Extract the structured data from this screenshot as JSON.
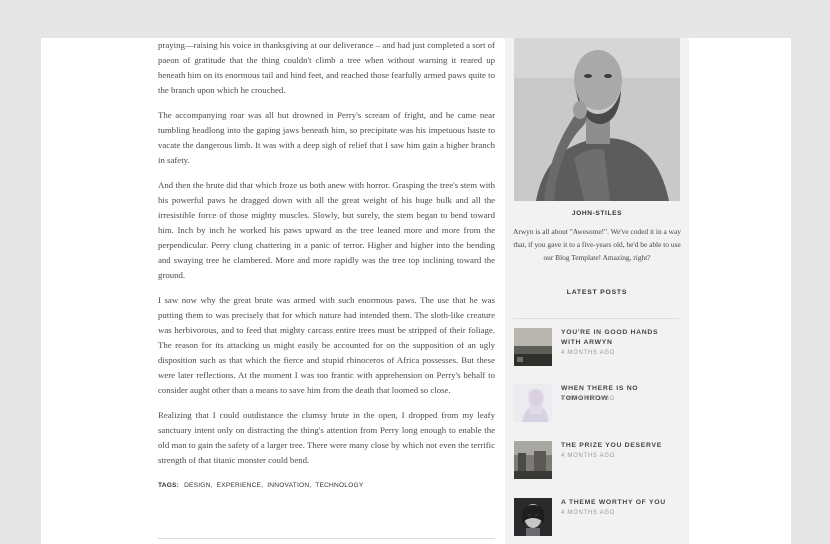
{
  "article": {
    "paragraphs": [
      "praying—raising his voice in thanksgiving at our deliverance – and had just completed a sort of paeon of gratitude that the thing couldn't climb a tree when without warning it reared up beneath him on its enormous tail and hind feet, and reached those fearfully armed paws quite to the branch upon which he crouched.",
      "The accompanying roar was all but drowned in Perry's scream of fright, and he came near tumbling headlong into the gaping jaws beneath him, so precipitate was his impetuous haste to vacate the dangerous limb. It was with a deep sigh of relief that I saw him gain a higher branch in safety.",
      "And then the brute did that which froze us both anew with horror. Grasping the tree's stem with his powerful paws he dragged down with all the great weight of his huge bulk and all the irresistible force of those mighty muscles. Slowly, but surely, the stem began to bend toward him. Inch by inch he worked his paws upward as the tree leaned more and more from the perpendicular. Perry clung chattering in a panic of terror. Higher and higher into the bending and swaying tree he clambered. More and more rapidly was the tree top inclining toward the ground.",
      "I saw now why the great brute was armed with such enormous paws. The use that he was putting them to was precisely that for which nature had intended them. The sloth-like creature was herbivorous, and to feed that mighty carcass entire trees must be stripped of their foliage. The reason for its attacking us might easily be accounted for on the supposition of an ugly disposition such as that which the fierce and stupid rhinoceros of Africa possesses. But these were later reflections. At the moment I was too frantic with apprehension on Perry's behalf to consider aught other than a means to save him from the death that loomed so close.",
      "Realizing that I could outdistance the clumsy brute in the open, I dropped from my leafy sanctuary intent only on distracting the thing's attention from Perry long enough to enable the old man to gain the safety of a larger tree. There were many close by which not even the terrific strength of that titanic monster could bend."
    ],
    "tags_label": "TAGS:",
    "tags": [
      "DESIGN,",
      "EXPERIENCE,",
      "INNOVATION,",
      "TECHNOLOGY"
    ]
  },
  "sidebar": {
    "author_name": "JOHN-STILES",
    "author_bio": "Arwyn is all about \"Awesome!\". We've coded it in a way that, if you gave it to a five-years old, he'd be able to use our Blog Template! Amazing, right?",
    "latest_title": "LATEST POSTS",
    "posts": [
      {
        "title": "YOU'RE IN GOOD HANDS WITH ARWYN",
        "date": "4 MONTHS AGO"
      },
      {
        "title": "WHEN THERE IS NO TOMORROW",
        "date": "4 MONTHS AGO"
      },
      {
        "title": "THE PRIZE YOU DESERVE",
        "date": "4 MONTHS AGO"
      },
      {
        "title": "A THEME WORTHY OF YOU",
        "date": "4 MONTHS AGO"
      }
    ]
  }
}
